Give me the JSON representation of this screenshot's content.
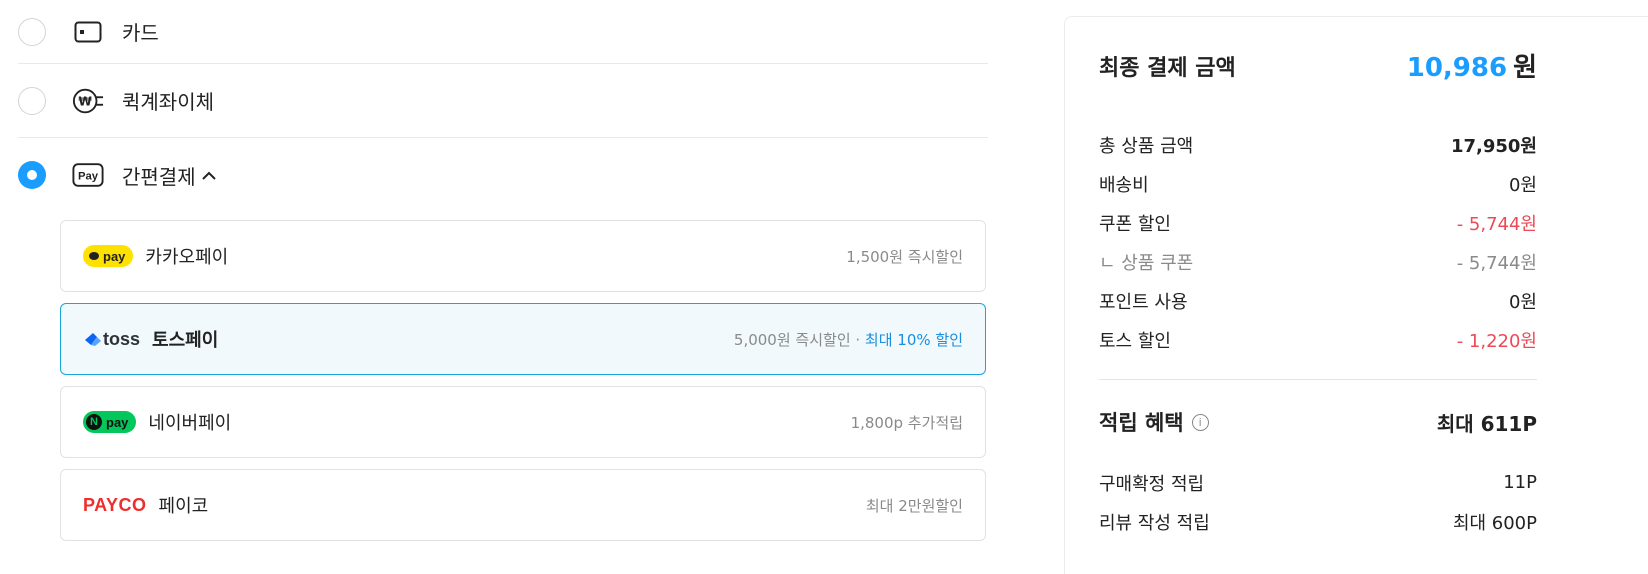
{
  "payment_methods": [
    {
      "label": "카드",
      "icon": "card-icon",
      "selected": false
    },
    {
      "label": "퀵계좌이체",
      "icon": "won-plug-icon",
      "selected": false
    },
    {
      "label": "간편결제",
      "icon": "pay-icon",
      "icon_text": "Pay",
      "selected": true,
      "chevron": "^"
    }
  ],
  "easy_pay": [
    {
      "logo_text": "pay",
      "name": "카카오페이",
      "benefit": "1,500원 즉시할인",
      "benefit_highlight": ""
    },
    {
      "logo_text": "toss",
      "name": "토스페이",
      "benefit": "5,000원 즉시할인 · ",
      "benefit_highlight": "최대 10% 할인"
    },
    {
      "logo_text": "pay",
      "logo_badge": "N",
      "name": "네이버페이",
      "benefit": "1,800p 추가적립",
      "benefit_highlight": ""
    },
    {
      "logo_text": "PAYCO",
      "name": "페이코",
      "benefit": "최대 2만원할인",
      "benefit_highlight": ""
    }
  ],
  "summary": {
    "final_label": "최종 결제 금액",
    "final_amount": "10,986",
    "final_unit": "원",
    "lines": [
      {
        "label": "총 상품 금액",
        "value": "17,950원"
      },
      {
        "label": "배송비",
        "value": "0원"
      },
      {
        "label": "쿠폰 할인",
        "value": "- 5,744원"
      },
      {
        "label": "ㄴ 상품 쿠폰",
        "value": "- 5,744원"
      },
      {
        "label": "포인트 사용",
        "value": "0원"
      },
      {
        "label": "토스 할인",
        "value": "- 1,220원"
      }
    ],
    "reward_label": "적립 혜택",
    "reward_info_icon": "i",
    "reward_value": "최대 611P",
    "reward_lines": [
      {
        "label": "구매확정 적립",
        "value": "11P"
      },
      {
        "label": "리뷰 작성 적립",
        "value": "최대 600P"
      }
    ]
  },
  "colors": {
    "accent": "#1a9dff",
    "discount_red": "#ec4a57",
    "toss_selected_border": "#19a6d8",
    "kakao_yellow": "#ffe100",
    "naver_green": "#03c75a",
    "payco_red": "#ee2d2d"
  }
}
